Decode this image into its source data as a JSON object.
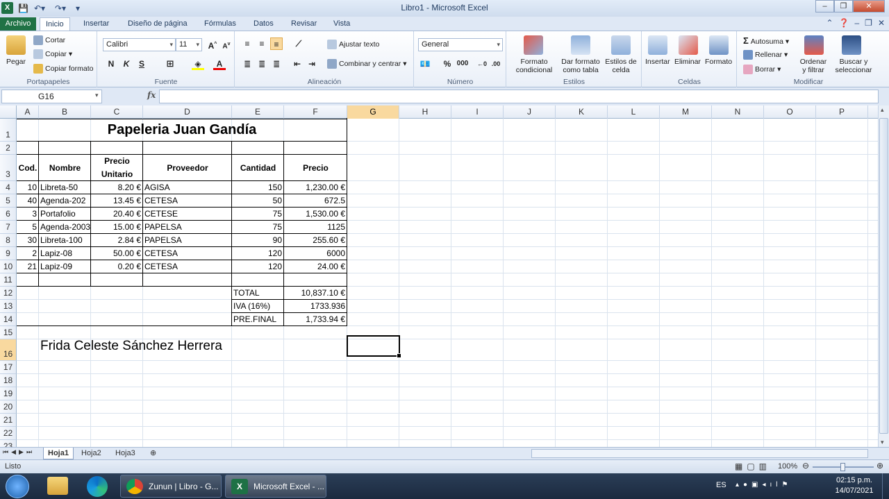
{
  "window": {
    "title": "Libro1  -  Microsoft Excel"
  },
  "ribbon_tabs": [
    "Archivo",
    "Inicio",
    "Insertar",
    "Diseño de página",
    "Fórmulas",
    "Datos",
    "Revisar",
    "Vista"
  ],
  "ribbon": {
    "clipboard": {
      "paste": "Pegar",
      "cut": "Cortar",
      "copy": "Copiar",
      "copy_format": "Copiar formato",
      "label": "Portapapeles"
    },
    "font": {
      "name": "Calibri",
      "size": "11",
      "bold": "N",
      "italic": "K",
      "underline": "S",
      "label": "Fuente"
    },
    "alignment": {
      "wrap": "Ajustar texto",
      "merge": "Combinar y centrar",
      "label": "Alineación"
    },
    "number": {
      "format": "General",
      "percent": "%",
      "thousands": "000",
      "label": "Número"
    },
    "styles": {
      "conditional": "Formato\ncondicional",
      "table": "Dar formato\ncomo tabla",
      "cell_styles": "Estilos de\ncelda",
      "label": "Estilos"
    },
    "cells": {
      "insert": "Insertar",
      "delete": "Eliminar",
      "format": "Formato",
      "label": "Celdas"
    },
    "editing": {
      "autosum": "Autosuma",
      "fill": "Rellenar",
      "clear": "Borrar",
      "sort": "Ordenar\ny filtrar",
      "find": "Buscar y\nseleccionar",
      "label": "Modificar"
    }
  },
  "formula_bar": {
    "name_box": "G16",
    "fx": "fx",
    "value": ""
  },
  "columns": [
    "A",
    "B",
    "C",
    "D",
    "E",
    "F",
    "G",
    "H",
    "I",
    "J",
    "K",
    "L",
    "M",
    "N",
    "O",
    "P"
  ],
  "rows": [
    "1",
    "2",
    "3",
    "4",
    "5",
    "6",
    "7",
    "8",
    "9",
    "10",
    "11",
    "12",
    "13",
    "14",
    "15",
    "16",
    "17",
    "18",
    "19",
    "20",
    "21",
    "22",
    "23"
  ],
  "sheet": {
    "title": "Papeleria Juan Gandía",
    "headers": {
      "cod": "Cod.",
      "nombre": "Nombre",
      "precio_unitario_1": "Precio",
      "precio_unitario_2": "Unitario",
      "proveedor": "Proveedor",
      "cantidad": "Cantidad",
      "precio": "Precio"
    },
    "items": [
      {
        "cod": "10",
        "nombre": "Libreta-50",
        "pu": "8.20 €",
        "proveedor": "AGISA",
        "cantidad": "150",
        "precio": "1,230.00 €"
      },
      {
        "cod": "40",
        "nombre": "Agenda-202",
        "pu": "13.45 €",
        "proveedor": "CETESA",
        "cantidad": "50",
        "precio": "672.5"
      },
      {
        "cod": "3",
        "nombre": "Portafolio",
        "pu": "20.40 €",
        "proveedor": "CETESE",
        "cantidad": "75",
        "precio": "1,530.00 €"
      },
      {
        "cod": "5",
        "nombre": "Agenda-2003",
        "pu": "15.00 €",
        "proveedor": "PAPELSA",
        "cantidad": "75",
        "precio": "1125"
      },
      {
        "cod": "30",
        "nombre": "Libreta-100",
        "pu": "2.84 €",
        "proveedor": "PAPELSA",
        "cantidad": "90",
        "precio": "255.60 €"
      },
      {
        "cod": "2",
        "nombre": "Lapiz-08",
        "pu": "50.00 €",
        "proveedor": "CETESA",
        "cantidad": "120",
        "precio": "6000"
      },
      {
        "cod": "21",
        "nombre": "Lapiz-09",
        "pu": "0.20 €",
        "proveedor": "CETESA",
        "cantidad": "120",
        "precio": "24.00 €"
      }
    ],
    "totals": [
      {
        "label": "TOTAL",
        "value": "10,837.10 €"
      },
      {
        "label": "IVA (16%)",
        "value": "1733.936"
      },
      {
        "label": "PRE.FINAL",
        "value": "1,733.94 €"
      }
    ],
    "author": "Frida Celeste Sánchez Herrera"
  },
  "sheet_tabs": [
    "Hoja1",
    "Hoja2",
    "Hoja3"
  ],
  "status": {
    "ready": "Listo",
    "zoom": "100%"
  },
  "taskbar": {
    "apps": [
      {
        "label": "Zunun | Libro - G...",
        "color": "#db4437"
      },
      {
        "label": "Microsoft Excel - ...",
        "color": "#1e7145"
      }
    ],
    "lang": "ES",
    "time": "02:15 p.m.",
    "date": "14/07/2021"
  }
}
